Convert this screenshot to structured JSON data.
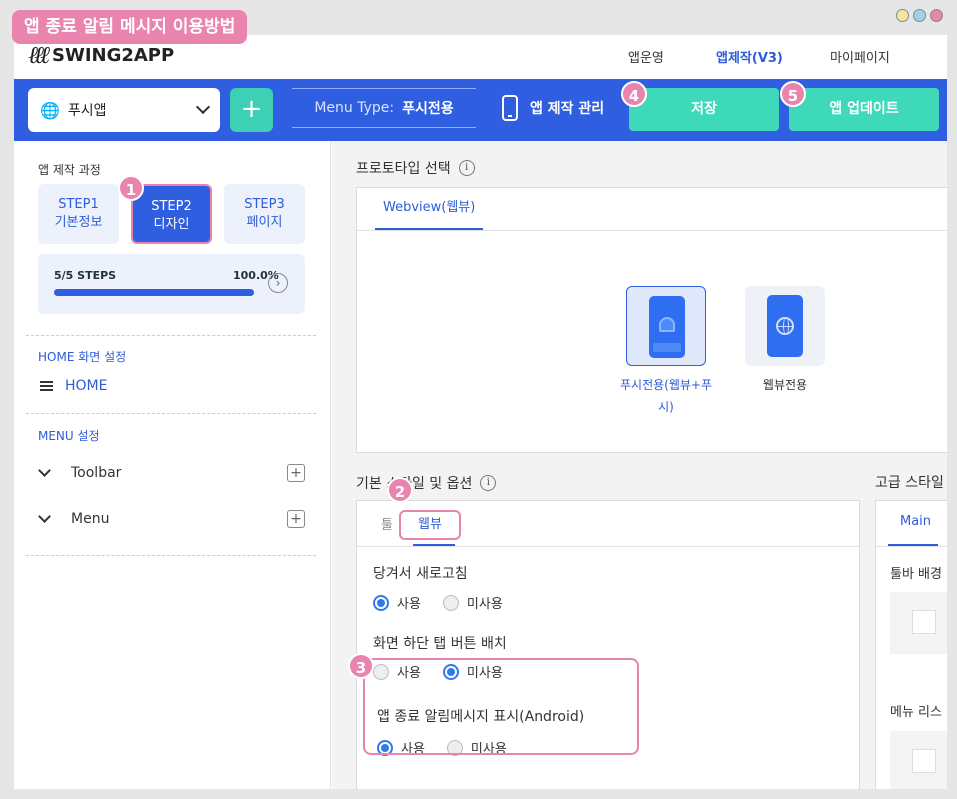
{
  "title_badge": "앱 종료 알림 메시지 이용방법",
  "window_dots": [
    "#f3e6a5",
    "#9fd0ee",
    "#e884ad"
  ],
  "nav": {
    "logo_text": "SWING2APP",
    "links": [
      "앱운영",
      "앱제작(V3)",
      "마이페이지"
    ],
    "active": "앱제작(V3)"
  },
  "toolbar": {
    "app_select": "푸시앱",
    "plus": "+",
    "menu_type_label": "Menu Type:",
    "menu_type_value": "푸시전용",
    "mgmt": "앱 제작 관리",
    "save": "저장",
    "update": "앱 업데이트"
  },
  "sidebar": {
    "process_title": "앱 제작 과정",
    "steps": [
      {
        "line1": "STEP1",
        "line2": "기본정보"
      },
      {
        "line1": "STEP2",
        "line2": "디자인"
      },
      {
        "line1": "STEP3",
        "line2": "페이지"
      }
    ],
    "progress_label": "5/5 STEPS",
    "progress_pct": "100.0%",
    "progress_value": 1.0,
    "home_section": "HOME 화면 설정",
    "home_item": "HOME",
    "menu_section": "MENU 설정",
    "tree": [
      "Toolbar",
      "Menu"
    ]
  },
  "main": {
    "prototype_title": "프로토타입 선택",
    "tab_webview": "Webview(웹뷰)",
    "proto_push_line1": "푸시전용(웹뷰+푸",
    "proto_push_line2": "시)",
    "proto_web": "웹뷰전용",
    "basic_title": "기본 스타일 및 옵션",
    "tab_toolbar_partial": "툴",
    "tab_webview_short": "웹뷰",
    "opt1": "당겨서 새로고침",
    "opt2": "화면 하단 탭 버튼 배치",
    "opt3": "앱 종료 알림메시지 표시(Android)",
    "use": "사용",
    "nouse": "미사용",
    "adv_title": "고급 스타일",
    "adv_tab": "Main",
    "adv_label1": "툴바 배경",
    "adv_label2": "메뉴 리스"
  },
  "badges": [
    "1",
    "2",
    "3",
    "4",
    "5"
  ],
  "colors": {
    "brand_blue": "#2f5fe0",
    "teal": "#3dd9b9",
    "highlight_pink": "#e884ad"
  }
}
